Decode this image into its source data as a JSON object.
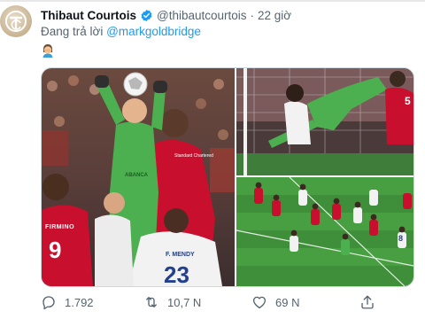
{
  "tweet": {
    "author_name": "Thibaut Courtois",
    "handle": "@thibautcourtois",
    "separator": "·",
    "time": "22 giờ",
    "reply_prefix": "Đang trả lời",
    "reply_to": "@markgoldbridge",
    "emoji": "woman-facepalming-emoji",
    "verified": true
  },
  "media": {
    "left_photo": {
      "shirt_number_left": "9",
      "shirt_name_left": "FIRMINO",
      "shirt_number_right": "23",
      "shirt_name_right": "F. MENDY",
      "sponsor_green": "ABANCA",
      "sponsor_red": "Standard Chartered"
    },
    "top_right_photo": {
      "shirt_number": "5"
    },
    "bottom_right_photo": {
      "shirt_number": "8"
    }
  },
  "actions": {
    "reply_count": "1.792",
    "retweet_count": "10,7 N",
    "like_count": "69 N",
    "share_label": ""
  },
  "colors": {
    "accent": "#1d9bf0",
    "text_secondary": "#536471",
    "keeper_green": "#4caf50",
    "liverpool_red": "#c8102e",
    "madrid_white": "#f2f2f2"
  },
  "icons": [
    "reply-icon",
    "retweet-icon",
    "like-icon",
    "share-icon",
    "verified-badge-icon"
  ]
}
